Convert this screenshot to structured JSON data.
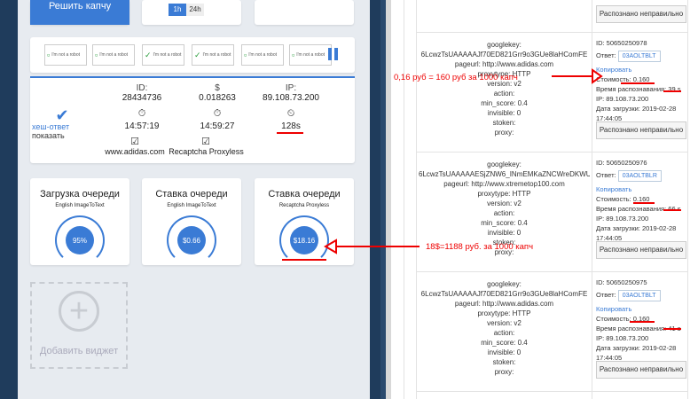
{
  "left": {
    "top_button_label": "Решить капчу",
    "toggle": {
      "a": "1h",
      "b": "24h"
    },
    "captchas": [
      {
        "label": "I'm not a robot",
        "checked": false
      },
      {
        "label": "I'm not a robot",
        "checked": false
      },
      {
        "label": "I'm not a robot",
        "checked": true
      },
      {
        "label": "I'm not a robot",
        "checked": true
      },
      {
        "label": "I'm not a robot",
        "checked": false
      },
      {
        "label": "I'm not a robot",
        "checked": false
      }
    ],
    "stats": {
      "id_label": "ID:",
      "id_value": "28434736",
      "usd_label": "$",
      "usd_value": "0.018263",
      "ip_label": "IP:",
      "ip_value": "89.108.73.200",
      "time1": "14:57:19",
      "time2": "14:59:27",
      "duration": "128s",
      "hash_link": "хеш-ответ",
      "show_link": "показать",
      "site": "www.adidas.com",
      "type": "Recaptcha Proxyless"
    },
    "widgets": [
      {
        "title": "Загрузка очереди",
        "sub": "English ImageToText",
        "value": "95%"
      },
      {
        "title": "Ставка очереди",
        "sub": "English ImageToText",
        "value": "$0.66"
      },
      {
        "title": "Ставка очереди",
        "sub": "Recaptcha Proxyless",
        "value": "$18.16"
      }
    ],
    "add_widget": "Добавить виджет",
    "annotation1": "0,16 руб = 160 руб за 1000 капч",
    "annotation2": "18$=1188 руб. за 1000 капч"
  },
  "right": {
    "wrong_button": "Распознано неправильно",
    "rows": [
      {
        "req": [
          "googlekey:",
          "6LcwzTsUAAAAAJf70ED821Grr9o3GUe8laHComFE",
          "pageurl: http://www.adidas.com",
          "proxytype: HTTP",
          "version: v2",
          "action:",
          "min_score: 0.4",
          "invisible: 0",
          "stoken:",
          "proxy:"
        ],
        "id": "ID: 50650250978",
        "answer_label": "Ответ:",
        "answer": "03AOLTBLT",
        "copy": "Копировать",
        "cost": "Стоимость: 0.160",
        "time": "Время распознавания: 39 s",
        "ip": "IP: 89.108.73.200",
        "date": "Дата загрузки: 2019-02-28 17:44:05"
      },
      {
        "req": [
          "googlekey:",
          "6LcwzTsUAAAAAESjZNW6_INmEMKaZNCWreDKWUxB",
          "pageurl: http://www.xtremetop100.com",
          "proxytype: HTTP",
          "version: v2",
          "action:",
          "min_score: 0.4",
          "invisible: 0",
          "stoken:",
          "proxy:"
        ],
        "id": "ID: 50650250976",
        "answer_label": "Ответ:",
        "answer": "03AOLTBLR",
        "copy": "Копировать",
        "cost": "Стоимость: 0.160",
        "time": "Время распознавания: 66 s",
        "ip": "IP: 89.108.73.200",
        "date": "Дата загрузки: 2019-02-28 17:44:05"
      },
      {
        "req": [
          "googlekey:",
          "6LcwzTsUAAAAAJf70ED821Grr9o3GUe8laHComFE",
          "pageurl: http://www.adidas.com",
          "proxytype: HTTP",
          "version: v2",
          "action:",
          "min_score: 0.4",
          "invisible: 0",
          "stoken:",
          "proxy:"
        ],
        "id": "ID: 50650250975",
        "answer_label": "Ответ:",
        "answer": "03AOLTBLT",
        "copy": "Копировать",
        "cost": "Стоимость: 0.160",
        "time": "Время распознавания: 41 s",
        "ip": "IP: 89.108.73.200",
        "date": "Дата загрузки: 2019-02-28 17:44:05"
      }
    ]
  },
  "colors": {
    "accent": "#3a7bd5",
    "annot": "#e00000",
    "sidebar": "#2a4a6e"
  }
}
